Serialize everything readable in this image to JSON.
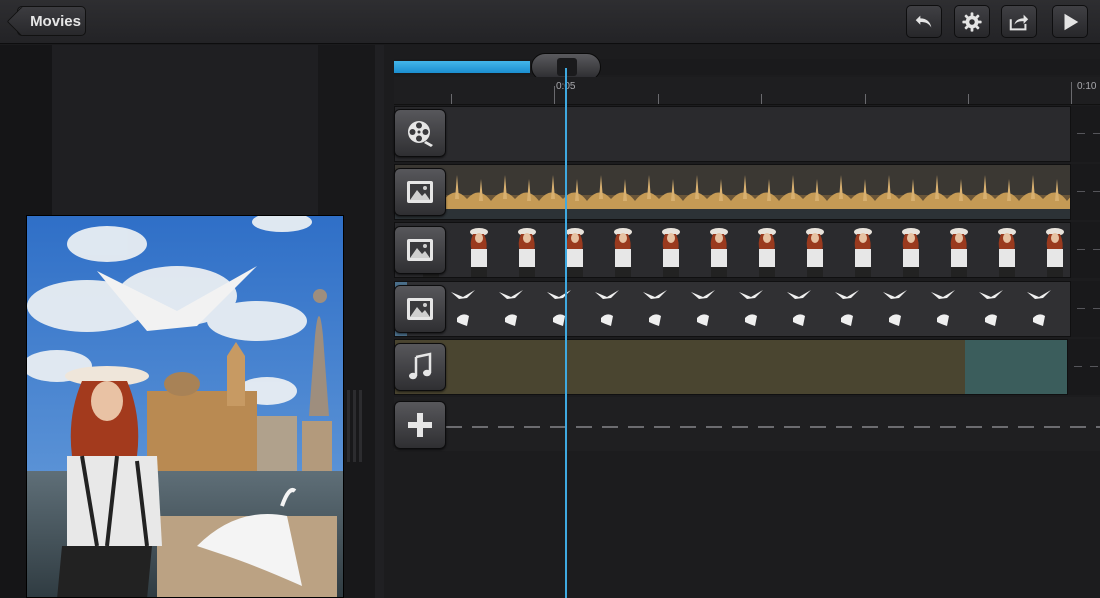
{
  "toolbar": {
    "back_label": "Movies",
    "buttons": [
      {
        "icon": "undo-icon"
      },
      {
        "icon": "gear-icon"
      },
      {
        "icon": "share-icon"
      },
      {
        "icon": "play-icon"
      }
    ]
  },
  "timeline": {
    "progress_percent": 19,
    "tick_labels": [
      "0:05",
      "0:10"
    ],
    "tracks": [
      {
        "name": "video-track",
        "icon": "film-reel-icon"
      },
      {
        "name": "image-track-basilica",
        "icon": "image-icon"
      },
      {
        "name": "image-track-woman",
        "icon": "image-icon"
      },
      {
        "name": "image-track-birds",
        "icon": "image-icon"
      },
      {
        "name": "audio-track",
        "icon": "music-note-icon"
      },
      {
        "name": "add-track",
        "icon": "plus-icon"
      }
    ]
  },
  "colors": {
    "accent": "#3fa9e0",
    "audio_clip": "#4a4530",
    "audio_clip_end": "#3b5d5c",
    "background": "#1c1c1e"
  }
}
